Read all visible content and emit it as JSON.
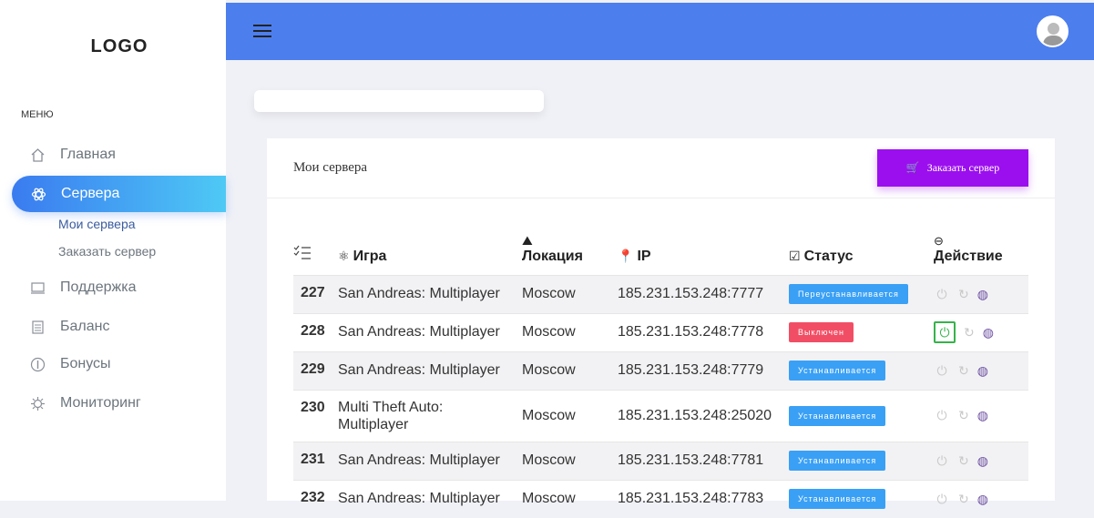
{
  "sidebar": {
    "logo": "LOGO",
    "menu_title": "МЕНЮ",
    "items": [
      {
        "label": "Главная",
        "icon": "home-icon"
      },
      {
        "label": "Сервера",
        "icon": "atom-icon"
      },
      {
        "label": "Поддержка",
        "icon": "support-icon"
      },
      {
        "label": "Баланс",
        "icon": "wallet-icon"
      },
      {
        "label": "Бонусы",
        "icon": "bonus-icon"
      },
      {
        "label": "Мониторинг",
        "icon": "monitoring-icon"
      }
    ],
    "sub_items": [
      {
        "label": "Мои сервера"
      },
      {
        "label": "Заказать сервер"
      }
    ]
  },
  "header": {
    "menu_icon": "hamburger-icon",
    "avatar": "user-avatar"
  },
  "card": {
    "title": "Мои сервера",
    "order_button": "Заказать сервер",
    "columns": [
      "",
      "Игра",
      "Локация",
      "IP",
      "Статус",
      "Действие"
    ],
    "rows": [
      {
        "id": "227",
        "game": "San Andreas: Multiplayer",
        "location": "Moscow",
        "ip": "185.231.153.248:7777",
        "status": "Переустанавливается",
        "status_color": "#3aa0f5"
      },
      {
        "id": "228",
        "game": "San Andreas: Multiplayer",
        "location": "Moscow",
        "ip": "185.231.153.248:7778",
        "status": "Выключен",
        "status_color": "#f14e65"
      },
      {
        "id": "229",
        "game": "San Andreas: Multiplayer",
        "location": "Moscow",
        "ip": "185.231.153.248:7779",
        "status": "Устанавливается",
        "status_color": "#3aa0f5"
      },
      {
        "id": "230",
        "game": "Multi Theft Auto: Multiplayer",
        "location": "Moscow",
        "ip": "185.231.153.248:25020",
        "status": "Устанавливается",
        "status_color": "#3aa0f5"
      },
      {
        "id": "231",
        "game": "San Andreas: Multiplayer",
        "location": "Moscow",
        "ip": "185.231.153.248:7781",
        "status": "Устанавливается",
        "status_color": "#3aa0f5"
      },
      {
        "id": "232",
        "game": "San Andreas: Multiplayer",
        "location": "Moscow",
        "ip": "185.231.153.248:7783",
        "status": "Устанавливается",
        "status_color": "#3aa0f5"
      }
    ]
  },
  "colors": {
    "topbar": "#4c7eee",
    "accent_button": "#9b0fee",
    "active_nav": "#3a7bf0"
  }
}
